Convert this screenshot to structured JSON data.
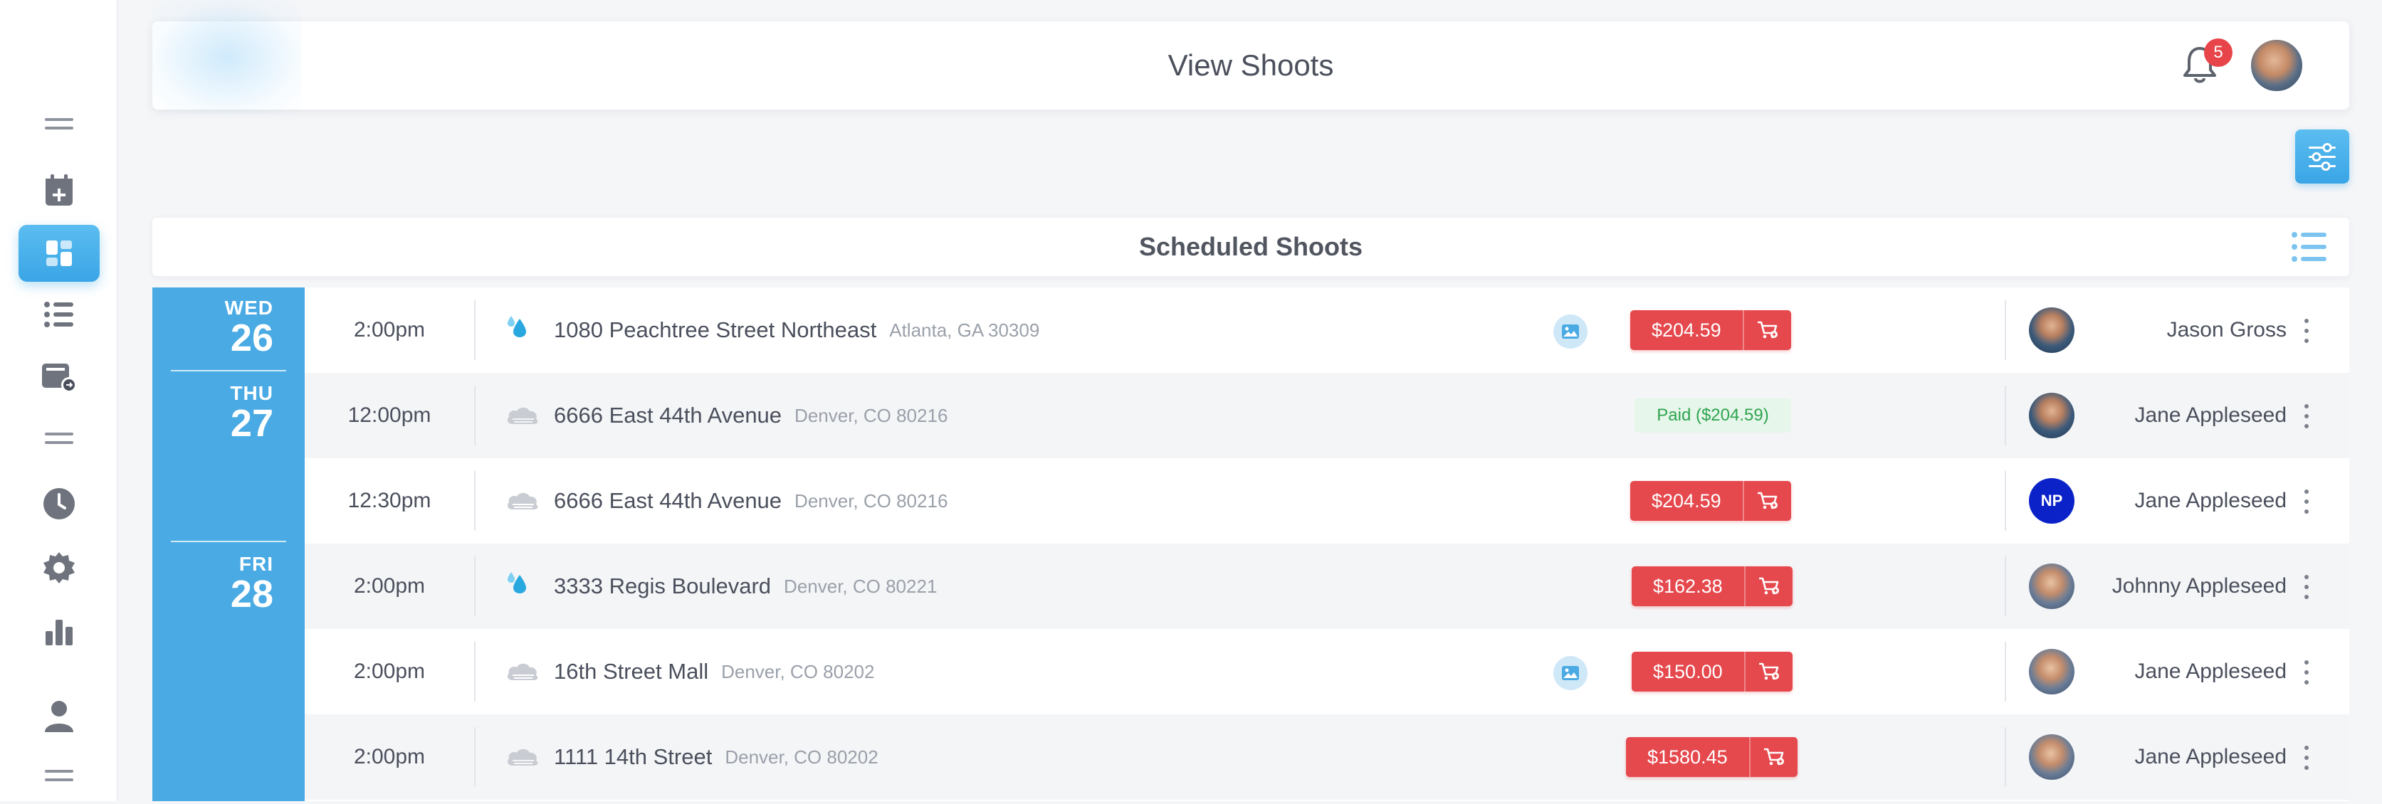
{
  "header": {
    "title": "View Shoots",
    "notification_count": "5"
  },
  "sidebar": {
    "items": [
      {
        "icon": "menu-icon"
      },
      {
        "icon": "calendar-add-icon"
      },
      {
        "icon": "dashboard-icon",
        "active": true
      },
      {
        "icon": "list-icon"
      },
      {
        "icon": "folder-share-icon"
      },
      {
        "icon": "menu-icon"
      },
      {
        "icon": "clock-icon"
      },
      {
        "icon": "gear-icon"
      },
      {
        "icon": "bar-chart-icon"
      },
      {
        "icon": "user-icon"
      },
      {
        "icon": "menu-icon"
      }
    ]
  },
  "section": {
    "title": "Scheduled Shoots"
  },
  "dates": [
    {
      "dow": "WED",
      "day": "26"
    },
    {
      "dow": "THU",
      "day": "27"
    },
    {
      "dow": "FRI",
      "day": "28"
    }
  ],
  "rows": [
    {
      "time": "2:00pm",
      "weather": "rain-icon",
      "street": "1080 Peachtree Street Northeast",
      "city": "Atlanta, GA 30309",
      "photos": true,
      "price": "$204.59",
      "paid": false,
      "person": "Jason Gross",
      "avatar": "photo"
    },
    {
      "time": "12:00pm",
      "weather": "cloud-icon",
      "street": "6666 East 44th Avenue",
      "city": "Denver, CO 80216",
      "photos": false,
      "price": "Paid ($204.59)",
      "paid": true,
      "person": "Jane Appleseed",
      "avatar": "photo"
    },
    {
      "time": "12:30pm",
      "weather": "cloud-icon",
      "street": "6666 East 44th Avenue",
      "city": "Denver, CO 80216",
      "photos": false,
      "price": "$204.59",
      "paid": false,
      "person": "Jane Appleseed",
      "avatar": "initials",
      "initials": "NP"
    },
    {
      "time": "2:00pm",
      "weather": "rain-icon",
      "street": "3333 Regis Boulevard",
      "city": "Denver, CO 80221",
      "photos": false,
      "price": "$162.38",
      "paid": false,
      "person": "Johnny Appleseed",
      "avatar": "photo"
    },
    {
      "time": "2:00pm",
      "weather": "cloud-icon",
      "street": "16th Street Mall",
      "city": "Denver, CO 80202",
      "photos": true,
      "price": "$150.00",
      "paid": false,
      "person": "Jane Appleseed",
      "avatar": "photo"
    },
    {
      "time": "2:00pm",
      "weather": "cloud-icon",
      "street": "1111 14th Street",
      "city": "Denver, CO 80202",
      "photos": false,
      "price": "$1580.45",
      "paid": false,
      "person": "Jane Appleseed",
      "avatar": "photo"
    }
  ],
  "colors": {
    "accent": "#4aaae4",
    "price": "#e5484d",
    "paid_bg": "#e6f6ea",
    "paid_text": "#2ea44f",
    "badge": "#e8454a"
  }
}
